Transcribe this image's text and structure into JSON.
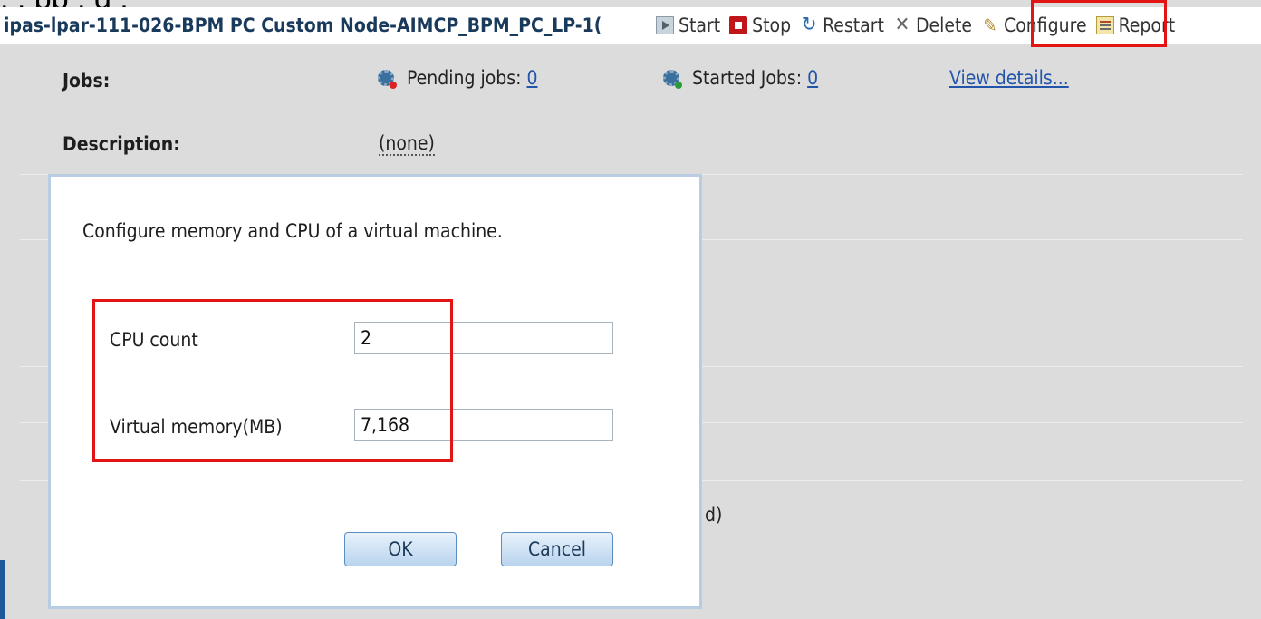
{
  "caption_fragment": "                                          , ,                                  pp  ,       g         ,",
  "toolbar": {
    "vm_title": "ipas-lpar-111-026-BPM PC Custom Node-AIMCP_BPM_PC_LP-1(",
    "start_label": "Start",
    "stop_label": "Stop",
    "restart_label": "Restart",
    "delete_label": "Delete",
    "configure_label": "Configure",
    "report_label": "Report"
  },
  "properties": {
    "jobs_label": "Jobs:",
    "pending_label": "Pending jobs:",
    "pending_count": "0",
    "started_label": "Started Jobs:",
    "started_count": "0",
    "view_details": "View details...",
    "description_label": "Description:",
    "description_value": "(none)",
    "background_trailing_text": "d)"
  },
  "dialog": {
    "description": "Configure memory and CPU of a virtual machine.",
    "cpu_label": "CPU count",
    "cpu_value": "2",
    "memory_label": "Virtual memory(MB)",
    "memory_value": "7,168",
    "ok_label": "OK",
    "cancel_label": "Cancel"
  },
  "colors": {
    "highlight": "#e31414",
    "title_text": "#1a3a5c",
    "link": "#2255aa",
    "dialog_border": "#b8cde4"
  }
}
